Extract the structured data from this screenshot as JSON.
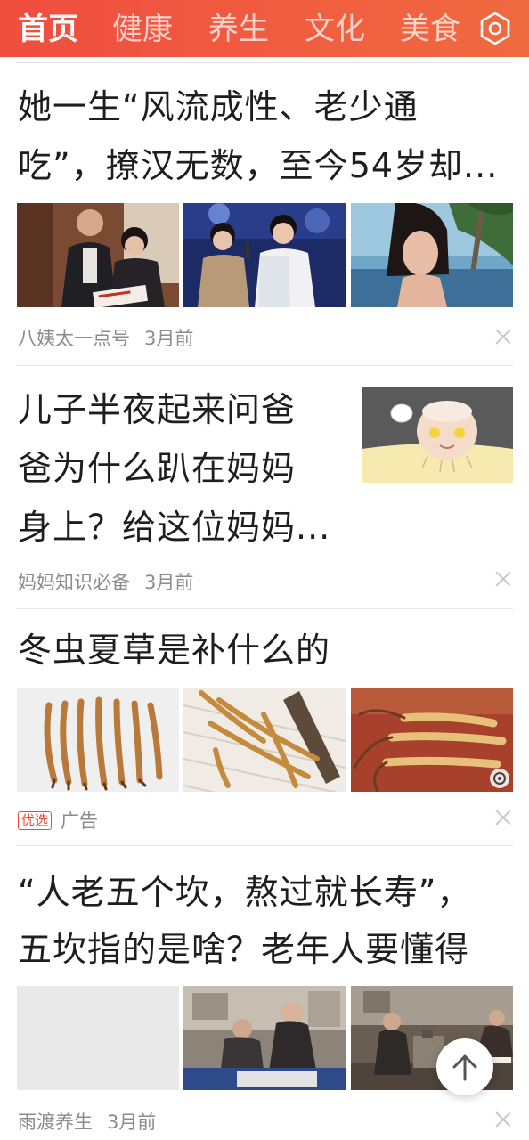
{
  "nav": {
    "tabs": [
      {
        "label": "首页",
        "active": true
      },
      {
        "label": "健康",
        "active": false
      },
      {
        "label": "养生",
        "active": false
      },
      {
        "label": "文化",
        "active": false
      },
      {
        "label": "美食",
        "active": false
      }
    ],
    "settings_icon": "hexagon-settings-icon",
    "accent_color": "#f04d3f"
  },
  "feed": [
    {
      "title_lines": [
        "她一生“风流成性、老少通",
        "吃”，撩汉无数，至今54岁却..."
      ],
      "source": "八姨太一点号",
      "time": "3月前"
    },
    {
      "title_lines": [
        "儿子半夜起来问爸",
        "爸为什么趴在妈妈",
        "身上？给这位妈妈..."
      ],
      "source": "妈妈知识必备",
      "time": "3月前"
    },
    {
      "title_lines": [
        "冬虫夏草是补什么的"
      ],
      "badge": "优选",
      "source": "广告"
    },
    {
      "title_lines": [
        "“人老五个坎，熬过就长寿”，",
        "五坎指的是啥？老年人要懂得"
      ],
      "source": "雨渡养生",
      "time": "3月前"
    }
  ],
  "back_to_top_icon": "arrow-up-icon"
}
